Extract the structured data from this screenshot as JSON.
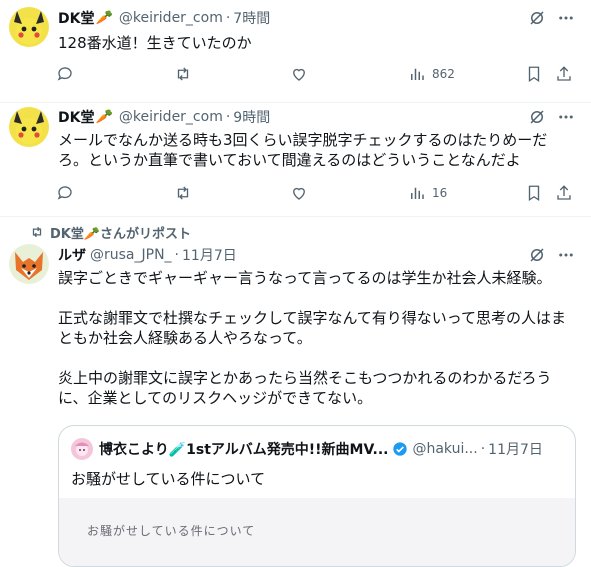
{
  "tweets": [
    {
      "name": "DK堂",
      "handle": "@keirider_com",
      "time": "7時間",
      "lines": [
        "128番水道！生きていたのか"
      ],
      "views": "862"
    },
    {
      "name": "DK堂",
      "handle": "@keirider_com",
      "time": "9時間",
      "lines": [
        "メールでなんか送る時も3回くらい誤字脱字チェックするのはたりめーだ",
        "ろ。というか直筆で書いておいて間違えるのはどういうことなんだよ"
      ],
      "views": "16"
    }
  ],
  "repost": {
    "reposter_text": "DK堂🥕さんがリポスト",
    "name": "ルザ",
    "handle": "@rusa_JPN_",
    "time": "11月7日",
    "paragraphs": [
      [
        "誤字ごときでギャーギャー言うなって言ってるのは学生か社会人未経験。"
      ],
      [
        "正式な謝罪文で杜撰なチェックして誤字なんて有り得ないって思考の人はま",
        "ともか社会人経験ある人やろなって。"
      ],
      [
        "炎上中の謝罪文に誤字とかあったら当然そこもつつかれるのわかるだろう",
        "に、企業としてのリスクヘッジができてない。"
      ]
    ],
    "quote": {
      "name": "博衣こより🧪1stアルバム発売中!!新曲MV...",
      "handle": "@hakui...",
      "time": "11月7日",
      "text": "お騒がせしている件について",
      "media_text": "お騒がせしている件について"
    }
  },
  "separator": "·",
  "colors": {
    "accent": "#1d9bf0",
    "muted": "#536471",
    "border": "#eff3f4"
  },
  "icons": [
    "grok-icon",
    "more-icon",
    "reply-icon",
    "retweet-icon",
    "like-icon",
    "views-icon",
    "bookmark-icon",
    "share-icon",
    "verified-badge-icon"
  ]
}
